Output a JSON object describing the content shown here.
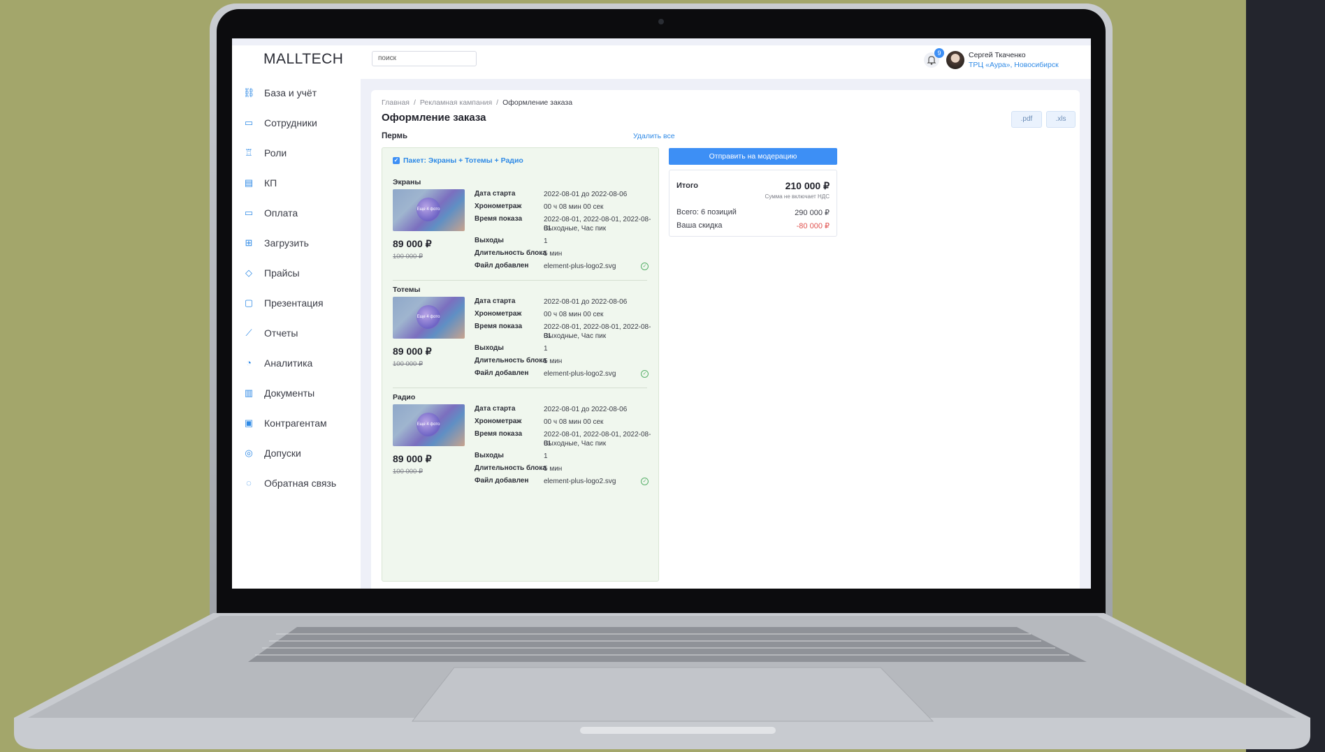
{
  "header": {
    "logo": "MALLTECH",
    "search_placeholder": "поиск",
    "notifications": "9",
    "user_name": "Сергей Ткаченко",
    "user_location": "ТРЦ «Аура», Новосибирск"
  },
  "sidebar": {
    "items": [
      {
        "label": "База и учёт",
        "icon": "network-icon"
      },
      {
        "label": "Сотрудники",
        "icon": "id-card-icon"
      },
      {
        "label": "Роли",
        "icon": "trophy-icon"
      },
      {
        "label": "КП",
        "icon": "clipboard-icon"
      },
      {
        "label": "Оплата",
        "icon": "wallet-icon"
      },
      {
        "label": "Загрузить",
        "icon": "upload-icon"
      },
      {
        "label": "Прайсы",
        "icon": "tag-icon"
      },
      {
        "label": "Презентация",
        "icon": "presentation-icon"
      },
      {
        "label": "Отчеты",
        "icon": "chart-icon"
      },
      {
        "label": "Аналитика",
        "icon": "pie-icon"
      },
      {
        "label": "Документы",
        "icon": "document-icon"
      },
      {
        "label": "Контрагентам",
        "icon": "briefcase-icon"
      },
      {
        "label": "Допуски",
        "icon": "coin-icon"
      },
      {
        "label": "Обратная связь",
        "icon": "chat-icon"
      }
    ]
  },
  "breadcrumb": [
    "Главная",
    "Рекламная кампания",
    "Оформление заказа"
  ],
  "page_title": "Оформление заказа",
  "export": {
    "pdf": ".pdf",
    "xls": ".xls"
  },
  "city": "Пермь",
  "delete_all": "Удалить все",
  "package_title": "Пакет: Экраны + Тотемы + Радио",
  "thumb_text": "Еще 4 фото",
  "labels": {
    "start": "Дата старта",
    "duration": "Хронометраж",
    "time": "Время показа",
    "outputs": "Выходы",
    "block": "Длительность блока",
    "file": "Файл добавлен"
  },
  "sections": [
    {
      "name": "Экраны",
      "price": "89 000 ₽",
      "old_price": "100 000 ₽",
      "start": "2022-08-01 до 2022-08-06",
      "duration": "00 ч 08 мин 00 сек",
      "time_line1": "2022-08-01, 2022-08-01, 2022-08-01",
      "time_line2": "Выходные, Час пик",
      "outputs": "1",
      "block": "5 мин",
      "file": "element-plus-logo2.svg"
    },
    {
      "name": "Тотемы",
      "price": "89 000 ₽",
      "old_price": "100 000 ₽",
      "start": "2022-08-01 до 2022-08-06",
      "duration": "00 ч 08 мин 00 сек",
      "time_line1": "2022-08-01, 2022-08-01, 2022-08-01",
      "time_line2": "Выходные, Час пик",
      "outputs": "1",
      "block": "5 мин",
      "file": "element-plus-logo2.svg"
    },
    {
      "name": "Радио",
      "price": "89 000 ₽",
      "old_price": "100 000 ₽",
      "start": "2022-08-01 до 2022-08-06",
      "duration": "00 ч 08 мин 00 сек",
      "time_line1": "2022-08-01, 2022-08-01, 2022-08-01",
      "time_line2": "Выходные, Час пик",
      "outputs": "1",
      "block": "5 мин",
      "file": "element-plus-logo2.svg"
    }
  ],
  "send_button": "Отправить на модерацию",
  "summary": {
    "title": "Итого",
    "total": "210 000 ₽",
    "vat_note": "Сумма не включает НДС",
    "count_label": "Всего: 6 позиций",
    "count_value": "290 000 ₽",
    "discount_label": "Ваша скидка",
    "discount_value": "-80 000 ₽"
  },
  "colors": {
    "accent": "#3d8ff5",
    "discount": "#e0524f",
    "package_bg": "#f0f7ee"
  }
}
